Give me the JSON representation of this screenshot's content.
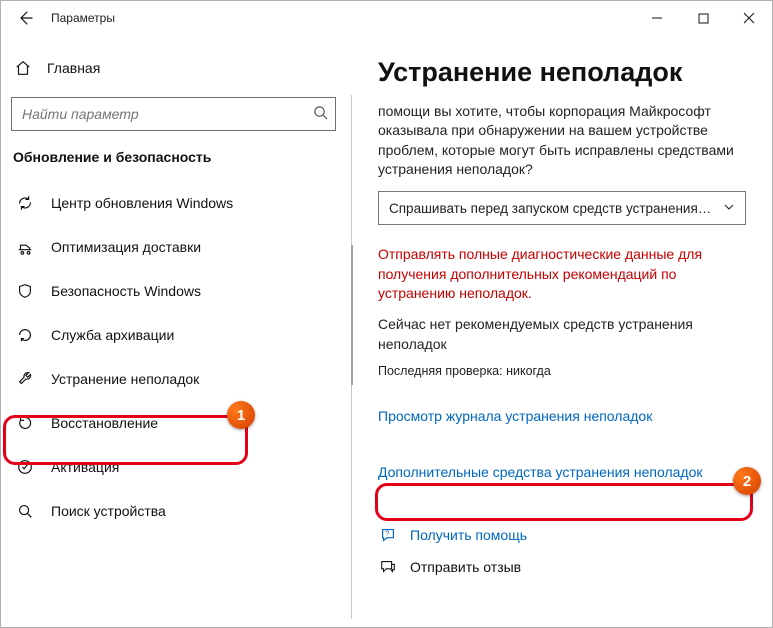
{
  "titlebar": {
    "app_title": "Параметры"
  },
  "sidebar": {
    "home": "Главная",
    "search_placeholder": "Найти параметр",
    "group_header": "Обновление и безопасность",
    "items": [
      {
        "label": "Центр обновления Windows"
      },
      {
        "label": "Оптимизация доставки"
      },
      {
        "label": "Безопасность Windows"
      },
      {
        "label": "Служба архивации"
      },
      {
        "label": "Устранение неполадок"
      },
      {
        "label": "Восстановление"
      },
      {
        "label": "Активация"
      },
      {
        "label": "Поиск устройства"
      }
    ]
  },
  "content": {
    "heading": "Устранение неполадок",
    "description": "помощи вы хотите, чтобы корпорация Майкрософт оказывала при обнаружении на вашем устройстве проблем, которые могут быть исправлены средствами устранения неполадок?",
    "dropdown_value": "Спрашивать перед запуском средств устранения…",
    "warning": "Отправлять полные диагностические данные для получения дополнительных рекомендаций по устранению неполадок.",
    "status": "Сейчас нет рекомендуемых средств устранения неполадок",
    "last_check": "Последняя проверка: никогда",
    "link_history": "Просмотр журнала устранения неполадок",
    "link_more": "Дополнительные средства устранения неполадок",
    "help": "Получить помощь",
    "feedback": "Отправить отзыв"
  },
  "annotations": {
    "badge1": "1",
    "badge2": "2"
  }
}
